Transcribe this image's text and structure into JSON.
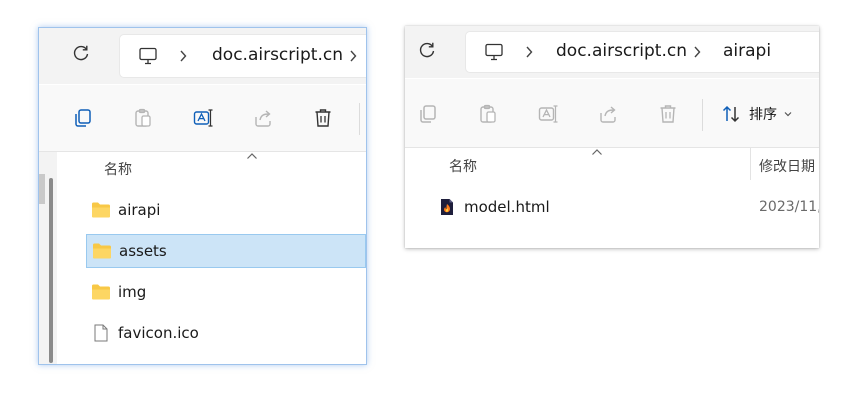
{
  "left_window": {
    "address_bar": {
      "crumbs": [
        "doc.airscript.cn"
      ]
    },
    "column_header": {
      "name_label": "名称"
    },
    "files": [
      {
        "name": "airapi",
        "type": "folder",
        "selected": false
      },
      {
        "name": "assets",
        "type": "folder",
        "selected": true
      },
      {
        "name": "img",
        "type": "folder",
        "selected": false
      },
      {
        "name": "favicon.ico",
        "type": "file",
        "selected": false
      }
    ]
  },
  "right_window": {
    "address_bar": {
      "crumbs": [
        "doc.airscript.cn",
        "airapi"
      ]
    },
    "toolbar": {
      "sort_label": "排序"
    },
    "column_header": {
      "name_label": "名称",
      "date_label": "修改日期"
    },
    "files": [
      {
        "name": "model.html",
        "type": "html-file",
        "date": "2023/11,"
      }
    ]
  },
  "colors": {
    "selection_bg": "#cce4f7",
    "selection_border": "#99c9ef",
    "folder_yellow": "#f8c846",
    "accent_blue": "#0067c0"
  }
}
